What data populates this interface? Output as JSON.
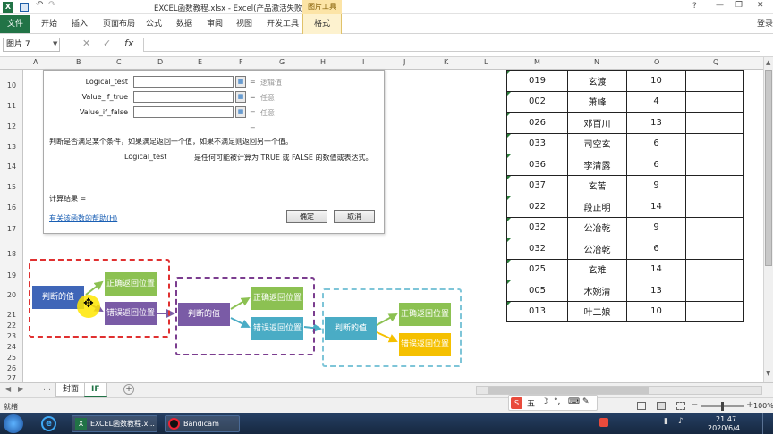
{
  "window": {
    "title": "EXCEL函数教程.xlsx - Excel(产品激活失败)",
    "tool_group": "图片工具",
    "help": "?",
    "minimize": "—",
    "restore": "❐",
    "close": "✕",
    "signin": "登录"
  },
  "ribbon": {
    "file": "文件",
    "tabs": [
      "开始",
      "插入",
      "页面布局",
      "公式",
      "数据",
      "审阅",
      "视图",
      "开发工具"
    ],
    "format_tab": "格式"
  },
  "formula_bar": {
    "name_box": "图片 7",
    "fx": "fx",
    "value": ""
  },
  "columns": [
    "A",
    "B",
    "C",
    "D",
    "E",
    "F",
    "G",
    "H",
    "I",
    "J",
    "K",
    "L",
    "M",
    "N",
    "O",
    "Q"
  ],
  "rows": [
    "10",
    "11",
    "12",
    "13",
    "14",
    "15",
    "16",
    "17",
    "18",
    "19",
    "20",
    "21",
    "22",
    "23",
    "24",
    "25",
    "26",
    "27"
  ],
  "dialog": {
    "args": [
      {
        "label": "Logical_test",
        "hint": "逻辑值"
      },
      {
        "label": "Value_if_true",
        "hint": "任意"
      },
      {
        "label": "Value_if_false",
        "hint": "任意"
      }
    ],
    "eq": "=",
    "description": "判断是否满足某个条件，如果满足返回一个值，如果不满足则返回另一个值。",
    "arg_name": "Logical_test",
    "arg_desc": "是任何可能被计算为 TRUE 或 FALSE 的数值或表达式。",
    "result_label": "计算结果 =",
    "help_link": "有关该函数的帮助(H)",
    "ok": "确定",
    "cancel": "取消"
  },
  "table": {
    "rows": [
      [
        "019",
        "玄渡",
        "10"
      ],
      [
        "002",
        "萧峰",
        "4"
      ],
      [
        "026",
        "邓百川",
        "13"
      ],
      [
        "033",
        "司空玄",
        "6"
      ],
      [
        "036",
        "李清露",
        "6"
      ],
      [
        "037",
        "玄苦",
        "9"
      ],
      [
        "022",
        "段正明",
        "14"
      ],
      [
        "032",
        "公冶乾",
        "9"
      ],
      [
        "032",
        "公冶乾",
        "6"
      ],
      [
        "025",
        "玄难",
        "14"
      ],
      [
        "005",
        "木婉清",
        "13"
      ],
      [
        "013",
        "叶二娘",
        "10"
      ]
    ]
  },
  "flowchart": {
    "judge": "判断的值",
    "correct": "正确返回位置",
    "wrong": "错误返回位置",
    "colors": {
      "red": "#e03030",
      "purple": "#7b3d8f",
      "cyan": "#7ec5d8",
      "blue": "#3f66b8",
      "green": "#8cc152",
      "violet": "#7a5ba6",
      "teal": "#4aacc5",
      "yellow": "#f5c000"
    }
  },
  "sheets": {
    "tabs": [
      "封面",
      "IF"
    ],
    "active": "IF",
    "add": "+"
  },
  "status": {
    "ready": "就绪",
    "zoom": "100%",
    "minus": "−",
    "plus": "+"
  },
  "taskbar": {
    "apps": [
      "EXCEL函数教程.x...",
      "Bandicam"
    ],
    "ime": "五",
    "time": "21:47",
    "date": "2020/6/4"
  }
}
